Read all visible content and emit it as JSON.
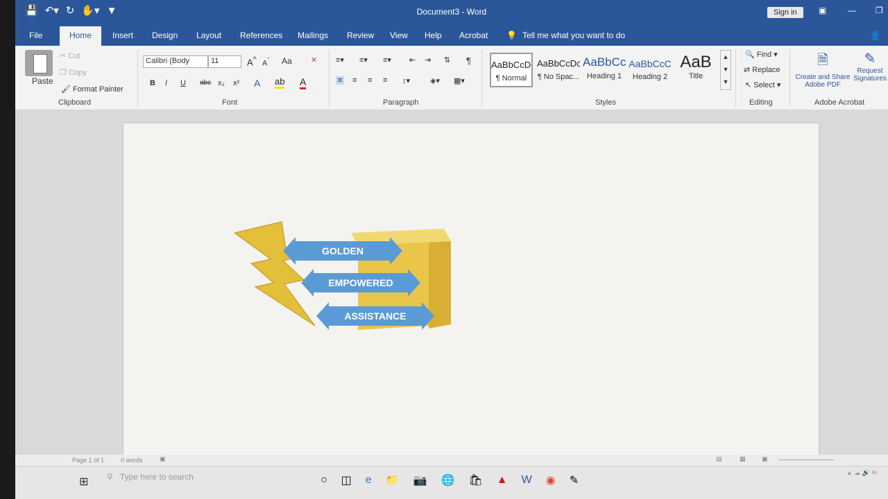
{
  "titlebar": {
    "title": "Document3  -  Word",
    "signin_label": "Sign in"
  },
  "tabs": [
    "File",
    "Home",
    "Insert",
    "Design",
    "Layout",
    "References",
    "Mailings",
    "Review",
    "View",
    "Help",
    "Acrobat"
  ],
  "tell_me": "Tell me what you want to do",
  "clipboard": {
    "paste": "Paste",
    "cut": "Cut",
    "copy": "Copy",
    "format_painter": "Format Painter",
    "label": "Clipboard"
  },
  "font": {
    "name": "Calibri (Body",
    "size": "11",
    "bold": "B",
    "italic": "I",
    "underline": "U",
    "strike": "abc",
    "sub": "x₂",
    "sup": "x²",
    "change_case": "Aa",
    "label": "Font"
  },
  "paragraph": {
    "label": "Paragraph",
    "pilcrow": "¶"
  },
  "styles": {
    "label": "Styles",
    "items": [
      {
        "sample": "AaBbCcDc",
        "name": "¶ Normal"
      },
      {
        "sample": "AaBbCcDc",
        "name": "¶ No Spac..."
      },
      {
        "sample": "AaBbCc",
        "name": "Heading 1"
      },
      {
        "sample": "AaBbCcC",
        "name": "Heading 2"
      },
      {
        "sample": "AaB",
        "name": "Title"
      }
    ]
  },
  "editing": {
    "find": "Find",
    "replace": "Replace",
    "select": "Select",
    "label": "Editing"
  },
  "acrobat": {
    "create_share": "Create and Share Adobe PDF",
    "request_sig": "Request Signatures",
    "label": "Adobe Acrobat"
  },
  "graphic": {
    "arrows": [
      "GOLDEN",
      "EMPOWERED",
      "ASSISTANCE"
    ],
    "colors": {
      "gold": "#e9c64a",
      "blue": "#5b9bd5"
    }
  },
  "status": {
    "page": "Page 1 of 1",
    "words": "0 words"
  },
  "taskbar": {
    "search_placeholder": "Type here to search"
  },
  "colors": {
    "accent": "#2b579a",
    "ribbon": "#f3f3f3"
  }
}
